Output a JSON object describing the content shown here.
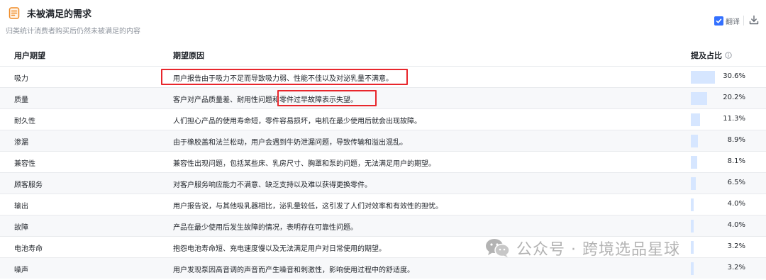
{
  "header": {
    "title": "未被满足的需求",
    "subtitle": "归类统计消费者购买后仍然未被满足的内容",
    "translate_label": "翻译",
    "icons": {
      "title": "document-icon",
      "download": "download-icon"
    },
    "accent_color": "#3370ff"
  },
  "table": {
    "columns": {
      "expectation": "用户期望",
      "reason": "期望原因",
      "share": "提及占比"
    },
    "rows": [
      {
        "expectation": "吸力",
        "reason": "用户报告由于吸力不足而导致吸力弱、性能不佳以及对泌乳量不满意。",
        "share": "30.6%",
        "value": 30.6
      },
      {
        "expectation": "质量",
        "reason": "客户对产品质量差、耐用性问题和零件过早故障表示失望。",
        "share": "20.2%",
        "value": 20.2
      },
      {
        "expectation": "耐久性",
        "reason": "人们担心产品的使用寿命短，零件容易损坏，电机在最少使用后就会出现故障。",
        "share": "11.3%",
        "value": 11.3
      },
      {
        "expectation": "渗漏",
        "reason": "由于橡胶盖和法兰松动，用户会遇到牛奶泄漏问题，导致传输和溢出混乱。",
        "share": "8.9%",
        "value": 8.9
      },
      {
        "expectation": "兼容性",
        "reason": "兼容性出现问题，包括某些床、乳房尺寸、胸罩和泵的问题，无法满足用户的期望。",
        "share": "8.1%",
        "value": 8.1
      },
      {
        "expectation": "顾客服务",
        "reason": "对客户服务响应能力不满意、缺乏支持以及难以获得更换零件。",
        "share": "6.5%",
        "value": 6.5
      },
      {
        "expectation": "输出",
        "reason": "用户报告说，与其他吸乳器相比，泌乳量较低，这引发了人们对效率和有效性的担忧。",
        "share": "4.0%",
        "value": 4.0
      },
      {
        "expectation": "故障",
        "reason": "产品在最少使用后发生故障的情况，表明存在可靠性问题。",
        "share": "4.0%",
        "value": 4.0
      },
      {
        "expectation": "电池寿命",
        "reason": "抱怨电池寿命短、充电速度慢以及无法满足用户对日常使用的期望。",
        "share": "3.2%",
        "value": 3.2
      },
      {
        "expectation": "噪声",
        "reason": "用户发现泵因高音调的声音而产生噪音和刺激性，影响使用过程中的舒适度。",
        "share": "3.2%",
        "value": 3.2
      }
    ]
  },
  "watermark": {
    "text": "公众号 · 跨境选品星球",
    "icon": "wechat-icon"
  },
  "colors": {
    "bar": "#d6e6ff",
    "highlight": "#e8262c",
    "row_alt": "#f7f8fa"
  }
}
